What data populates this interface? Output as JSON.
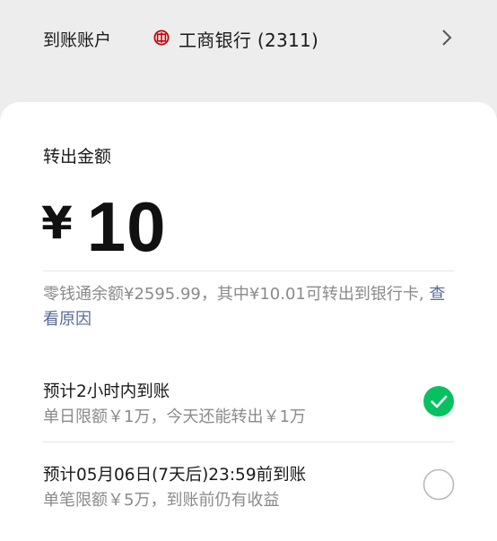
{
  "account": {
    "label": "到账账户",
    "bank_icon": "icbc-logo-icon",
    "bank_name": "工商银行 (2311)",
    "bank_color": "#c7000b"
  },
  "transfer": {
    "label": "转出金额",
    "currency": "¥",
    "amount": "10"
  },
  "balance": {
    "text": "零钱通余额¥2595.99，其中¥10.01可转出到银行卡, ",
    "link_label": "查看原因"
  },
  "options": [
    {
      "title": "预计2小时内到账",
      "subtitle": "单日限额￥1万，今天还能转出￥1万",
      "selected": true
    },
    {
      "title": "预计05月06日(7天后)23:59前到账",
      "subtitle": "单笔限额￥5万，到账前仍有收益",
      "selected": false
    }
  ],
  "colors": {
    "accent": "#07c160",
    "link": "#576b95",
    "muted_text": "#8a8a8a",
    "background": "#ededed"
  }
}
